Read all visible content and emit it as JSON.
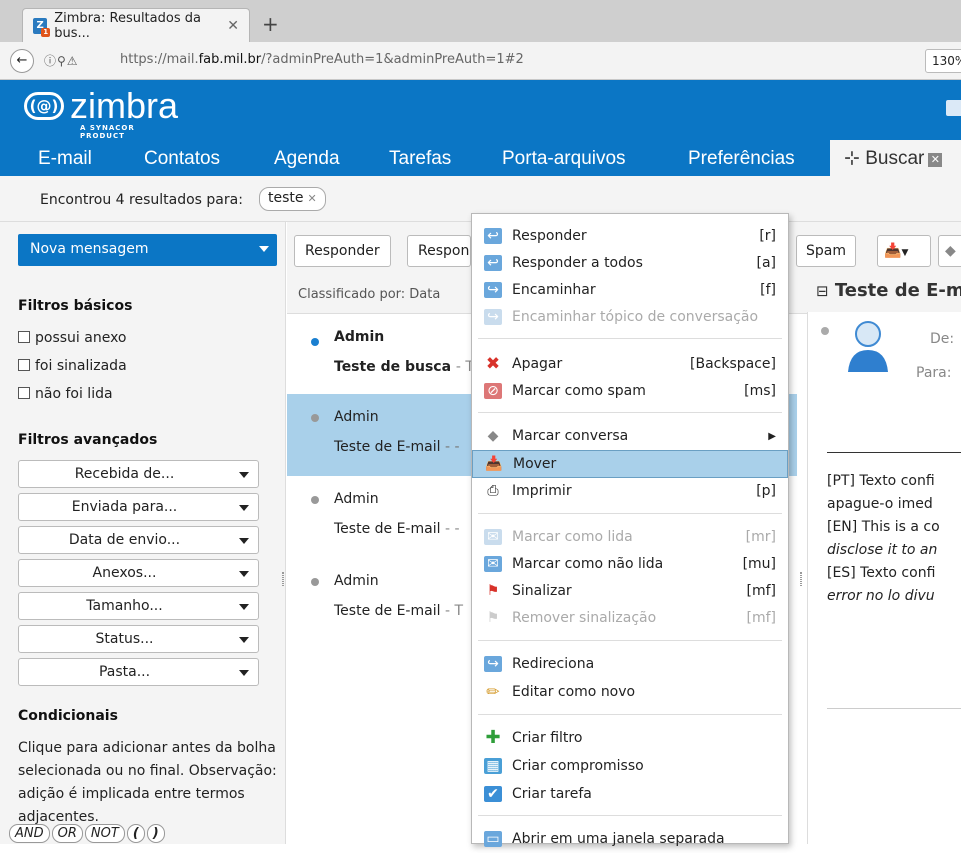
{
  "browser": {
    "tab_title": "Zimbra: Resultados da bus...",
    "tab_close": "✕",
    "new_tab": "+",
    "url_prefix": "https://mail.",
    "url_domain": "fab.mil.br",
    "url_suffix": "/?adminPreAuth=1&adminPreAuth=1#2",
    "zoom": "130%"
  },
  "brand": {
    "name": "zimbra",
    "tagline": "A SYNACOR PRODUCT"
  },
  "nav": {
    "items": [
      "E-mail",
      "Contatos",
      "Agenda",
      "Tarefas",
      "Porta-arquivos",
      "Preferências"
    ],
    "active_tab": "Buscar"
  },
  "search": {
    "result_text": "Encontrou 4 resultados para:",
    "term": "teste"
  },
  "sidebar": {
    "new_message": "Nova mensagem",
    "basic_filters_title": "Filtros básicos",
    "basic_filters": [
      "possui anexo",
      "foi sinalizada",
      "não foi lida"
    ],
    "advanced_filters_title": "Filtros avançados",
    "advanced_filters": [
      "Recebida de...",
      "Enviada para...",
      "Data de envio...",
      "Anexos...",
      "Tamanho...",
      "Status...",
      "Pasta..."
    ],
    "conditionals_title": "Condicionais",
    "conditionals_text": "Clique para adicionar antes da bolha selecionada ou no final. Observação: adição é implicada entre termos adjacentes.",
    "operators": [
      "AND",
      "OR",
      "NOT",
      "(",
      ")"
    ]
  },
  "toolbar": {
    "reply": "Responder",
    "reply_all": "Responder a todos",
    "spam": "Spam"
  },
  "list": {
    "sort_label": "Classificado por: Data",
    "messages": [
      {
        "sender": "Admin",
        "subject": "Teste de busca",
        "snippet": "- T",
        "unread": true
      },
      {
        "sender": "Admin",
        "subject": "Teste de E-mail",
        "snippet": "- -",
        "unread": false
      },
      {
        "sender": "Admin",
        "subject": "Teste de E-mail",
        "snippet": "- -",
        "unread": false
      },
      {
        "sender": "Admin",
        "subject": "Teste de E-mail",
        "snippet": "- T",
        "unread": false
      }
    ]
  },
  "reading": {
    "title": "Teste de E-m",
    "from_label": "De:",
    "to_label": "Para:",
    "body_lines": [
      "[PT] Texto confi",
      "apague-o imed",
      "[EN] This is a co",
      "disclose it to an",
      "[ES] Texto confi",
      "error no lo divu"
    ]
  },
  "context_menu": [
    {
      "label": "Responder",
      "shortcut": "[r]",
      "icon": "reply-icon",
      "disabled": false
    },
    {
      "label": "Responder a todos",
      "shortcut": "[a]",
      "icon": "reply-all-icon",
      "disabled": false
    },
    {
      "label": "Encaminhar",
      "shortcut": "[f]",
      "icon": "forward-icon",
      "disabled": false
    },
    {
      "label": "Encaminhar tópico de conversação",
      "shortcut": "",
      "icon": "forward-conversation-icon",
      "disabled": true
    },
    {
      "label": "Apagar",
      "shortcut": "[Backspace]",
      "icon": "delete-icon",
      "disabled": false
    },
    {
      "label": "Marcar como spam",
      "shortcut": "[ms]",
      "icon": "spam-icon",
      "disabled": false
    },
    {
      "label": "Marcar conversa",
      "shortcut": "",
      "icon": "tag-icon",
      "disabled": false,
      "submenu": true
    },
    {
      "label": "Mover",
      "shortcut": "",
      "icon": "move-icon",
      "disabled": false,
      "highlighted": true
    },
    {
      "label": "Imprimir",
      "shortcut": "[p]",
      "icon": "print-icon",
      "disabled": false
    },
    {
      "label": "Marcar como lida",
      "shortcut": "[mr]",
      "icon": "mark-read-icon",
      "disabled": true
    },
    {
      "label": "Marcar como não lida",
      "shortcut": "[mu]",
      "icon": "mark-unread-icon",
      "disabled": false
    },
    {
      "label": "Sinalizar",
      "shortcut": "[mf]",
      "icon": "flag-icon",
      "disabled": false
    },
    {
      "label": "Remover sinalização",
      "shortcut": "[mf]",
      "icon": "unflag-icon",
      "disabled": true
    },
    {
      "label": "Redireciona",
      "shortcut": "",
      "icon": "redirect-icon",
      "disabled": false
    },
    {
      "label": "Editar como novo",
      "shortcut": "",
      "icon": "edit-icon",
      "disabled": false
    },
    {
      "label": "Criar filtro",
      "shortcut": "",
      "icon": "add-filter-icon",
      "disabled": false
    },
    {
      "label": "Criar compromisso",
      "shortcut": "",
      "icon": "calendar-icon",
      "disabled": false
    },
    {
      "label": "Criar tarefa",
      "shortcut": "",
      "icon": "task-icon",
      "disabled": false
    },
    {
      "label": "Abrir em uma janela separada",
      "shortcut": "",
      "icon": "new-window-icon",
      "disabled": false
    }
  ],
  "colors": {
    "brand_blue": "#0b76c5",
    "selection": "#a9d0ea",
    "unread_dot": "#1a7fd0"
  }
}
